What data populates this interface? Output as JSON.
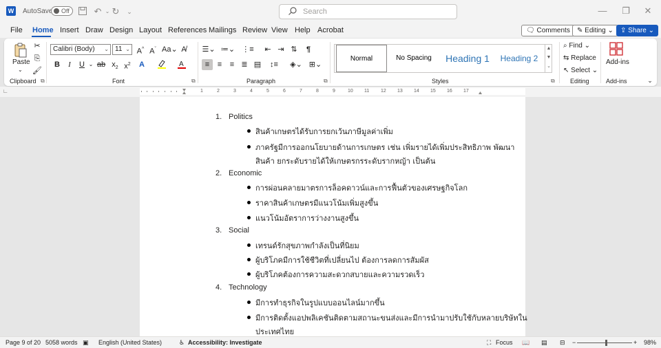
{
  "titlebar": {
    "app_letter": "W",
    "autosave_label": "AutoSave",
    "autosave_state": "Off",
    "search_placeholder": "Search"
  },
  "menu": {
    "tabs": [
      "File",
      "Home",
      "Insert",
      "Draw",
      "Design",
      "Layout",
      "References",
      "Mailings",
      "Review",
      "View",
      "Help",
      "Acrobat"
    ],
    "active_tab": "Home",
    "comments_label": "Comments",
    "editing_label": "Editing",
    "share_label": "Share"
  },
  "ribbon": {
    "clipboard": {
      "paste_label": "Paste",
      "group_label": "Clipboard"
    },
    "font": {
      "font_name": "Calibri (Body)",
      "font_size": "11",
      "group_label": "Font"
    },
    "paragraph": {
      "group_label": "Paragraph"
    },
    "styles": {
      "group_label": "Styles",
      "items": [
        "Normal",
        "No Spacing",
        "Heading 1",
        "Heading 2"
      ]
    },
    "editing": {
      "find_label": "Find",
      "replace_label": "Replace",
      "select_label": "Select",
      "group_label": "Editing"
    },
    "addins": {
      "addins_label": "Add-ins",
      "group_label": "Add-ins"
    }
  },
  "ruler": {
    "numbers": [
      "1",
      "2",
      "3",
      "4",
      "5",
      "6",
      "7",
      "8",
      "9",
      "10",
      "11",
      "12",
      "13",
      "14",
      "15",
      "16",
      "17"
    ]
  },
  "document": {
    "sections": [
      {
        "number": "1.",
        "title": "Politics",
        "bullets": [
          [
            "สินค้าเกษตรได้รับการยกเว้นภาษีมูลค่าเพิ่ม"
          ],
          [
            "ภาครัฐมีการออกนโยบายด้านการเกษตร เช่น เพิ่มรายได้เพิ่มประสิทธิภาพ พัฒนา",
            "สินค้า ยกระดับรายได้ให้เกษตรกรระดับรากหญ้า เป็นต้น"
          ]
        ]
      },
      {
        "number": "2.",
        "title": "Economic",
        "bullets": [
          [
            "การผ่อนคลายมาตรการล็อคดาวน์และการฟื้นตัวของเศรษฐกิจโลก"
          ],
          [
            "ราคาสินค้าเกษตรมีแนวโน้มเพิ่มสูงขึ้น"
          ],
          [
            "แนวโน้มอัตราการว่างงานสูงขึ้น"
          ]
        ]
      },
      {
        "number": "3.",
        "title": "Social",
        "bullets": [
          [
            "เทรนด์รักสุขภาพกำลังเป็นที่นิยม"
          ],
          [
            "ผู้บริโภคมีการใช้ชีวิตที่เปลี่ยนไป ต้องการลดการสัมผัส"
          ],
          [
            "ผู้บริโภคต้องการความสะดวกสบายและความรวดเร็ว"
          ]
        ]
      },
      {
        "number": "4.",
        "title": "Technology",
        "bullets": [
          [
            "มีการทำธุรกิจในรูปแบบออนไลน์มากขึ้น"
          ],
          [
            "มีการติดตั้งแอปพลิเคชันติดตามสถานะขนส่งและมีการนำมาปรับใช้กับหลายบริษัทใน",
            "ประเทศไทย"
          ]
        ]
      }
    ]
  },
  "status": {
    "page": "Page 9 of 20",
    "words": "5058 words",
    "language": "English (United States)",
    "accessibility": "Accessibility: Investigate",
    "focus": "Focus",
    "zoom": "98%"
  },
  "colors": {
    "accent": "#185abd",
    "heading_style": "#2e74b5"
  }
}
